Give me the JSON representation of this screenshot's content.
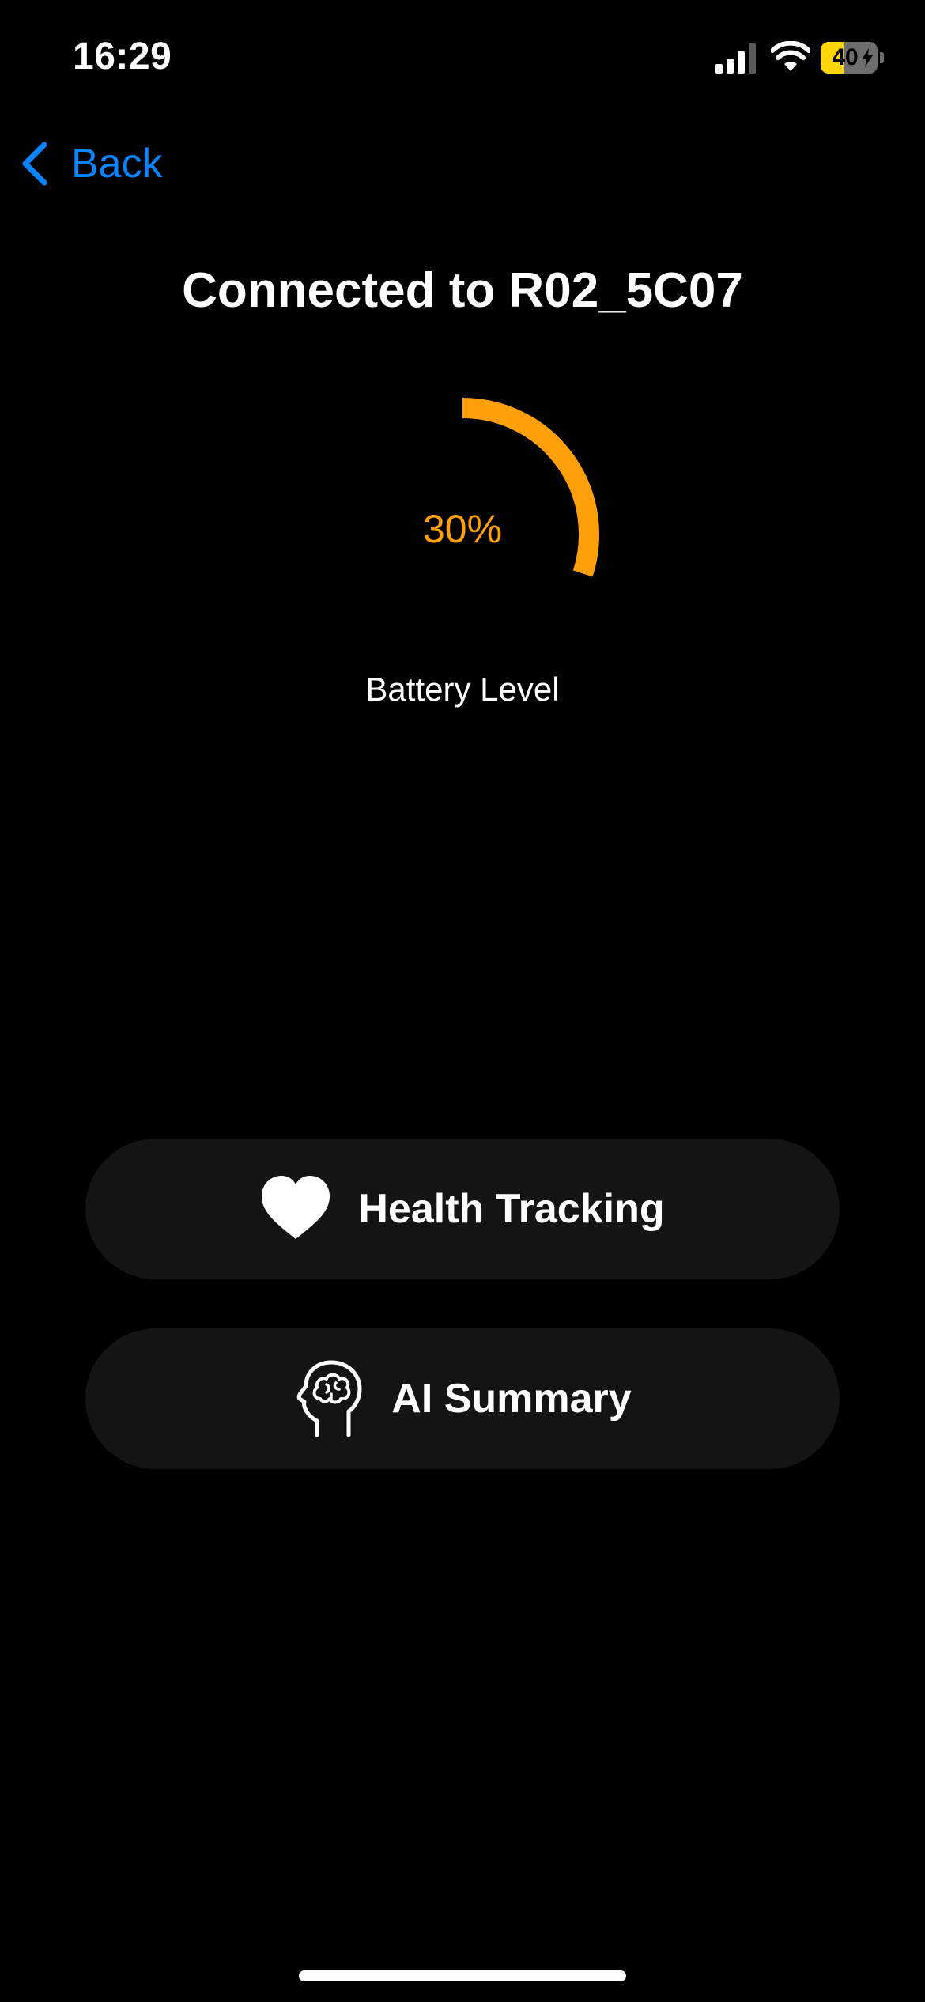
{
  "status_bar": {
    "time": "16:29",
    "battery_percent": "40",
    "battery_level": 0.4,
    "battery_charging": true
  },
  "nav": {
    "back_label": "Back"
  },
  "header": {
    "title": "Connected to R02_5C07"
  },
  "battery": {
    "value_text": "30%",
    "level": 0.3,
    "caption": "Battery Level"
  },
  "actions": [
    {
      "label": "Health Tracking",
      "icon": "heart-icon"
    },
    {
      "label": "AI Summary",
      "icon": "head-brain-icon"
    }
  ],
  "colors": {
    "accent_blue": "#0a84ff",
    "gauge_orange": "#ff9f0a",
    "battery_yellow": "#ffd60a",
    "button_bg": "#141414",
    "background": "#000000"
  }
}
